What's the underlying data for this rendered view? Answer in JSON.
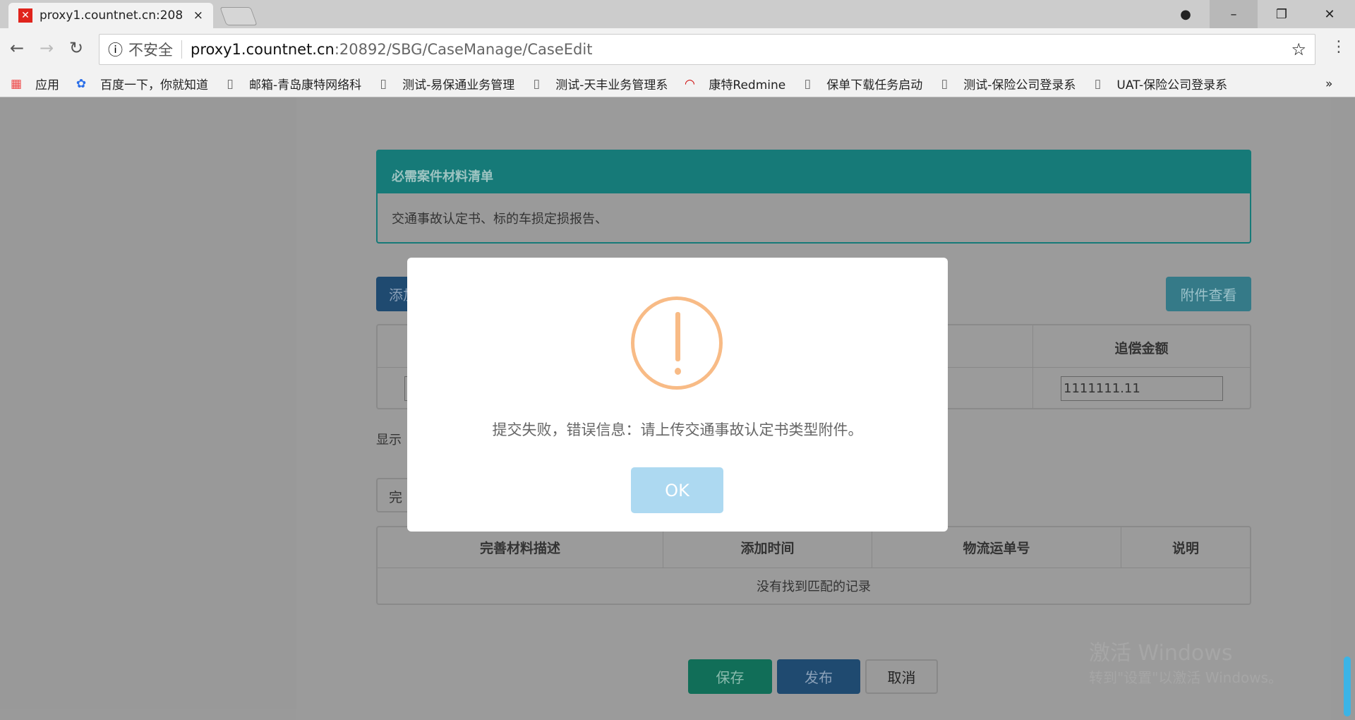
{
  "browser": {
    "tab_title": "proxy1.countnet.cn:208",
    "tab_close": "×",
    "url_security": "不安全",
    "url_host": "proxy1.countnet.cn",
    "url_path": ":20892/SBG/CaseManage/CaseEdit",
    "bookmarks": [
      "应用",
      "百度一下，你就知道",
      "邮箱-青岛康特网络科",
      "测试-易保通业务管理",
      "测试-天丰业务管理系",
      "康特Redmine",
      "保单下载任务启动",
      "测试-保险公司登录系",
      "UAT-保险公司登录系"
    ],
    "bookmarks_more": "»"
  },
  "panel": {
    "title": "必需案件材料清单",
    "body": "交通事故认定书、标的车损定损报告、"
  },
  "toolbar": {
    "add_label": "添加",
    "attach_label": "附件查看"
  },
  "table1": {
    "header_visible": "追偿金额",
    "amount_value": "1111111.11"
  },
  "show_text": "显示",
  "select_text": "完",
  "table2": {
    "columns": [
      "完善材料描述",
      "添加时间",
      "物流运单号",
      "说明"
    ],
    "empty": "没有找到匹配的记录"
  },
  "actions": {
    "save": "保存",
    "publish": "发布",
    "cancel": "取消"
  },
  "watermark": {
    "line1": "激活 Windows",
    "line2": "转到\"设置\"以激活 Windows。"
  },
  "modal": {
    "message": "提交失败，错误信息：请上传交通事故认定书类型附件。",
    "ok": "OK",
    "icon": "warning-icon",
    "icon_color": "#f8bb86"
  }
}
